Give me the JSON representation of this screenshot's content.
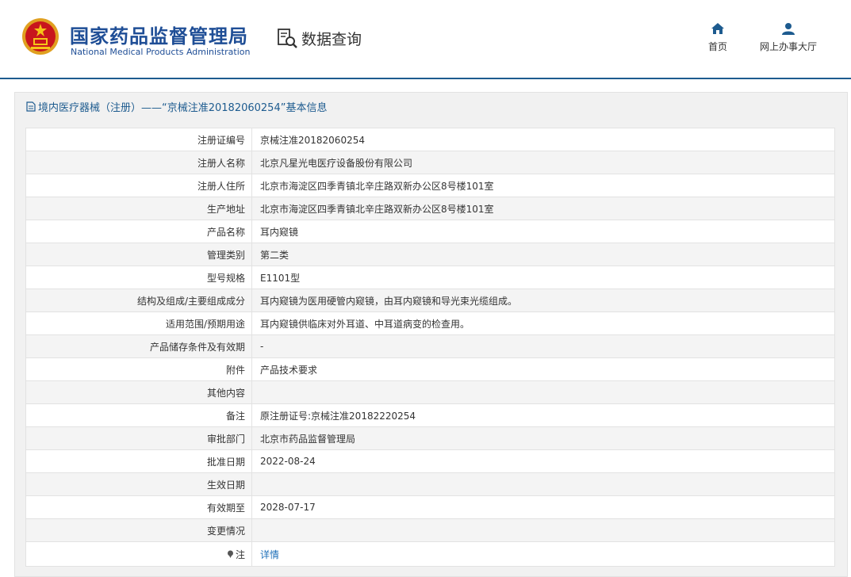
{
  "header": {
    "org_name_cn": "国家药品监督管理局",
    "org_name_en": "National Medical Products Administration",
    "query_label": "数据查询",
    "nav": [
      {
        "label": "首页",
        "icon": "home-icon"
      },
      {
        "label": "网上办事大厅",
        "icon": "user-icon"
      }
    ]
  },
  "panel": {
    "title": "境内医疗器械（注册）——“京械注准20182060254”基本信息"
  },
  "rows": [
    {
      "label": "注册证编号",
      "value": "京械注准20182060254"
    },
    {
      "label": "注册人名称",
      "value": "北京凡星光电医疗设备股份有限公司"
    },
    {
      "label": "注册人住所",
      "value": "北京市海淀区四季青镇北辛庄路双新办公区8号楼101室"
    },
    {
      "label": "生产地址",
      "value": "北京市海淀区四季青镇北辛庄路双新办公区8号楼101室"
    },
    {
      "label": "产品名称",
      "value": "耳内窥镜"
    },
    {
      "label": "管理类别",
      "value": "第二类"
    },
    {
      "label": "型号规格",
      "value": "E1101型"
    },
    {
      "label": "结构及组成/主要组成成分",
      "value": "耳内窥镜为医用硬管内窥镜，由耳内窥镜和导光束光缆组成。"
    },
    {
      "label": "适用范围/预期用途",
      "value": "耳内窥镜供临床对外耳道、中耳道病变的检查用。"
    },
    {
      "label": "产品储存条件及有效期",
      "value": "-"
    },
    {
      "label": "附件",
      "value": "产品技术要求"
    },
    {
      "label": "其他内容",
      "value": ""
    },
    {
      "label": "备注",
      "value": "原注册证号:京械注准20182220254"
    },
    {
      "label": "审批部门",
      "value": "北京市药品监督管理局"
    },
    {
      "label": "批准日期",
      "value": "2022-08-24"
    },
    {
      "label": "生效日期",
      "value": ""
    },
    {
      "label": "有效期至",
      "value": "2028-07-17"
    },
    {
      "label": "变更情况",
      "value": ""
    },
    {
      "label": "注",
      "value": "详情"
    }
  ],
  "colors": {
    "brand_blue": "#1f4e96",
    "title_blue": "#1d5b8f",
    "link_blue": "#1d6fb8"
  }
}
